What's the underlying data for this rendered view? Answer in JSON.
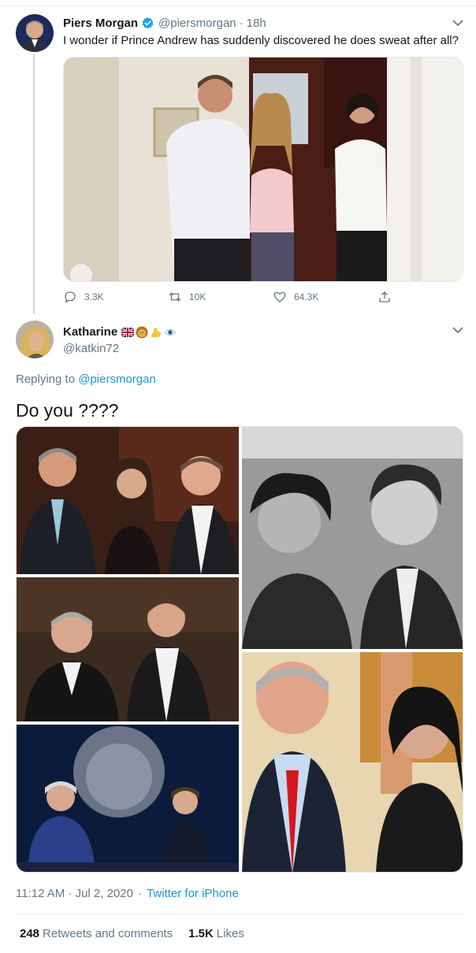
{
  "tweet1": {
    "author_name": "Piers Morgan",
    "handle": "@piersmorgan",
    "separator": "·",
    "time": "18h",
    "text": "I wonder if Prince Andrew has suddenly discovered he does sweat after all?",
    "actions": {
      "reply_count": "3.3K",
      "retweet_count": "10K",
      "like_count": "64.3K"
    }
  },
  "tweet2": {
    "author_name": "Katharine",
    "name_emojis": [
      "uk-flag",
      "lion",
      "flexed-biceps",
      "eye"
    ],
    "handle": "@katkin72",
    "replying_prefix": "Replying to",
    "replying_handle": "@piersmorgan",
    "text": "Do you ????",
    "timestamp": "11:12 AM · Jul 2, 2020",
    "separator": "·",
    "source": "Twitter for iPhone",
    "retweets_count": "248",
    "retweets_label": "Retweets and comments",
    "likes_count": "1.5K",
    "likes_label": "Likes"
  },
  "colors": {
    "verified": "#1da1f2",
    "link": "#1b95e0",
    "muted": "#657786",
    "text": "#14171a"
  }
}
